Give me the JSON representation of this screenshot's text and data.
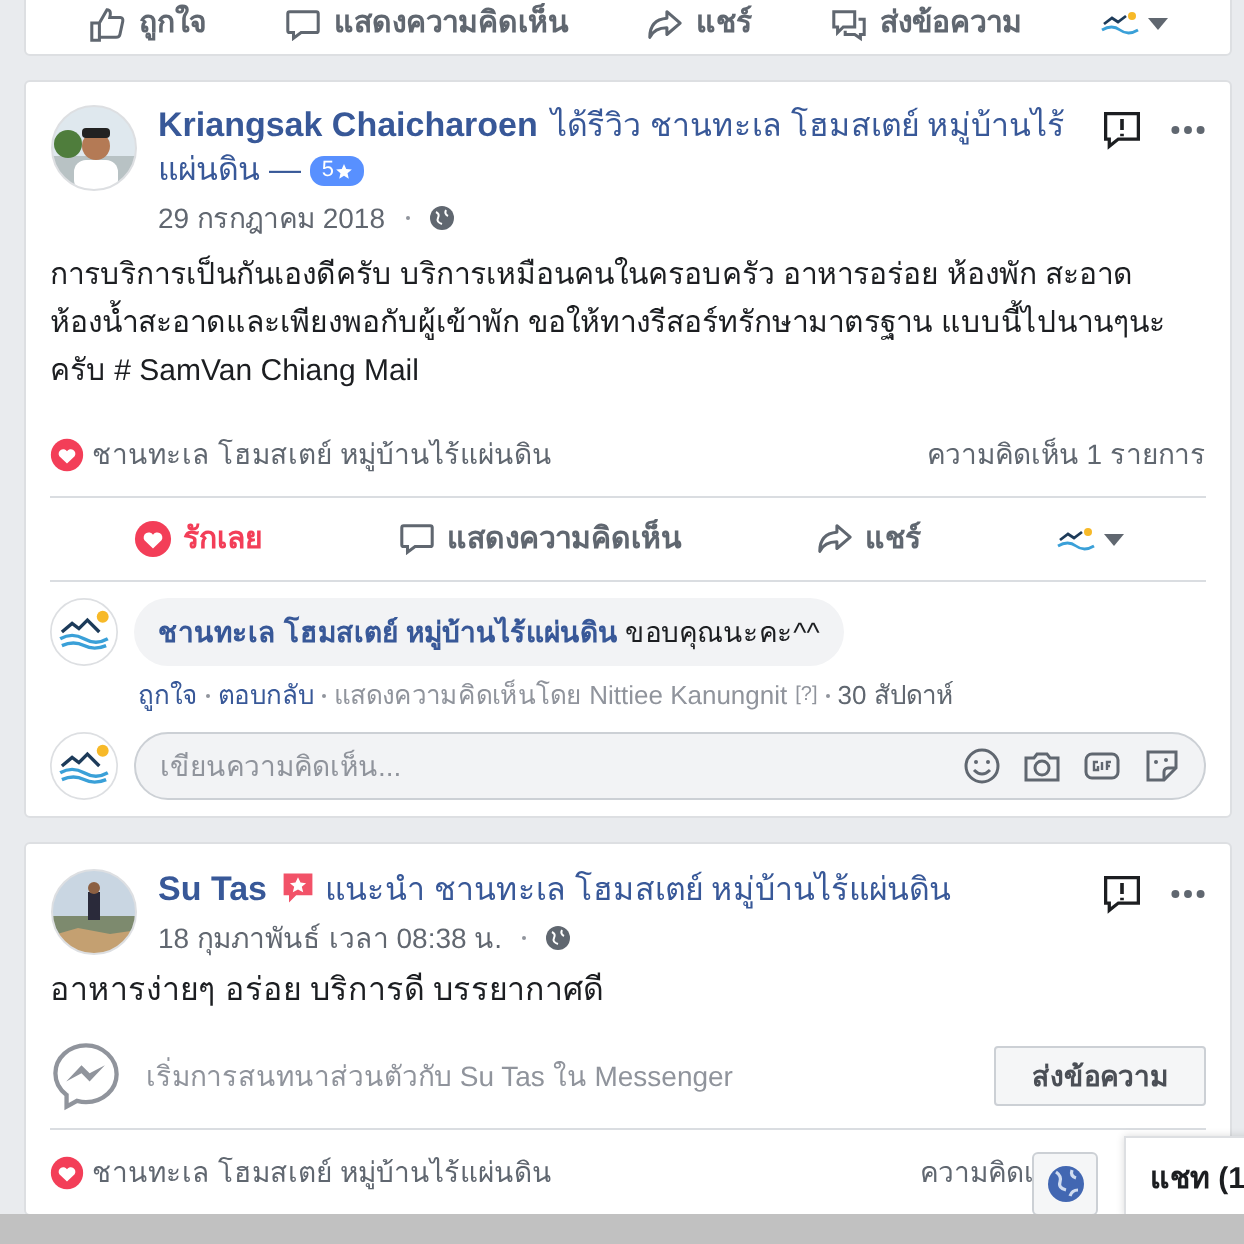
{
  "top_actions": [
    {
      "kind": "like",
      "label": "ถูกใจ"
    },
    {
      "kind": "comment",
      "label": "แสดงความคิดเห็น"
    },
    {
      "kind": "share",
      "label": "แชร์"
    },
    {
      "kind": "message",
      "label": "ส่งข้อความ"
    }
  ],
  "posts": [
    {
      "kind": "review",
      "author": "Kriangsak Chaicharoen",
      "headline": "ได้รีวิว ชานทะเล โฮมสเตย์ หมู่บ้านไร้แผ่นดิน —",
      "rating": "5",
      "date": "29 กรกฎาคม 2018",
      "body": "การบริการเป็นกันเองดีครับ บริการเหมือนคนในครอบครัว อาหารอร่อย ห้องพัก สะอาด ห้องน้ำสะอาดและเพียงพอกับผู้เข้าพัก ขอให้ทางรีสอร์ทรักษามาตรฐาน แบบนี้ไปนานๆนะครับ # SamVan Chiang Mail",
      "reactors": "ชานทะเล โฮมสเตย์ หมู่บ้านไร้แผ่นดิน",
      "comment_count": "ความคิดเห็น 1 รายการ",
      "actions": [
        {
          "kind": "love",
          "label": "รักเลย",
          "selected": true
        },
        {
          "kind": "comment",
          "label": "แสดงความคิดเห็น",
          "selected": false
        },
        {
          "kind": "share",
          "label": "แชร์",
          "selected": false
        }
      ],
      "comment": {
        "author": "ชานทะเล โฮมสเตย์ หมู่บ้านไร้แผ่นดิน",
        "text": "ขอบคุณนะคะ^^",
        "like": "ถูกใจ",
        "reply": "ตอบกลับ",
        "by": "แสดงความคิดเห็นโดย Nittiee Kanungnit",
        "help": "[?]",
        "time": "30 สัปดาห์"
      },
      "write_placeholder": "เขียนความคิดเห็น..."
    },
    {
      "kind": "recommend",
      "author": "Su Tas",
      "headline": "แนะนำ ชานทะเล โฮมสเตย์ หมู่บ้านไร้แผ่นดิน",
      "date": "18 กุมภาพันธ์ เวลา 08:38 น.",
      "body": "อาหารง่ายๆ อร่อย บริการดี บรรยากาศดี",
      "messenger_prompt": "เริ่มการสนทนาส่วนตัวกับ Su Tas ใน Messenger",
      "message_button": "ส่งข้อความ",
      "reactors": "ชานทะเล โฮมสเตย์ หมู่บ้านไร้แผ่นดิน",
      "comment_count": "ความคิดเ"
    }
  ],
  "chat": {
    "label": "แชท (1"
  }
}
